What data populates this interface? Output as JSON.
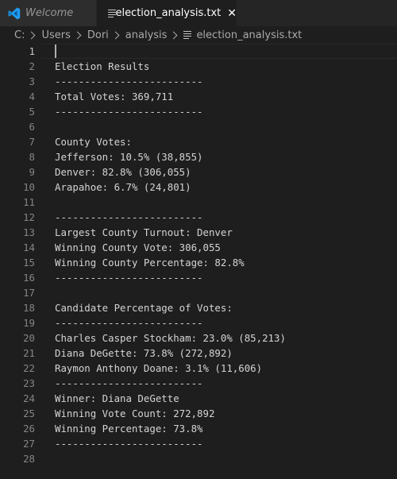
{
  "tabs": [
    {
      "label": "Welcome",
      "active": false
    },
    {
      "label": "election_analysis.txt",
      "active": true
    }
  ],
  "breadcrumb": [
    "C:",
    "Users",
    "Dori",
    "analysis",
    "election_analysis.txt"
  ],
  "editor": {
    "cursor_line": 1,
    "lines": [
      "",
      "Election Results",
      "-------------------------",
      "Total Votes: 369,711",
      "-------------------------",
      "",
      "County Votes:",
      "Jefferson: 10.5% (38,855)",
      "Denver: 82.8% (306,055)",
      "Arapahoe: 6.7% (24,801)",
      "",
      "-------------------------",
      "Largest County Turnout: Denver",
      "Winning County Vote: 306,055",
      "Winning County Percentage: 82.8%",
      "-------------------------",
      "",
      "Candidate Percentage of Votes:",
      "-------------------------",
      "Charles Casper Stockham: 23.0% (85,213)",
      "Diana DeGette: 73.8% (272,892)",
      "Raymon Anthony Doane: 3.1% (11,606)",
      "-------------------------",
      "Winner: Diana DeGette",
      "Winning Vote Count: 272,892",
      "Winning Percentage: 73.8%",
      "-------------------------",
      ""
    ]
  },
  "colors": {
    "editor_background": "#1e1e1e",
    "tab_bar": "#252526",
    "inactive_tab": "#2d2d2d",
    "vscode_blue": "#1f9cf0",
    "text": "#d4d4d4",
    "line_number": "#858585"
  },
  "icons": {
    "welcome_tab": "vscode-logo-icon",
    "file_tab": "text-file-icon",
    "close": "close-icon",
    "breadcrumb_separator": "chevron-right-icon"
  }
}
